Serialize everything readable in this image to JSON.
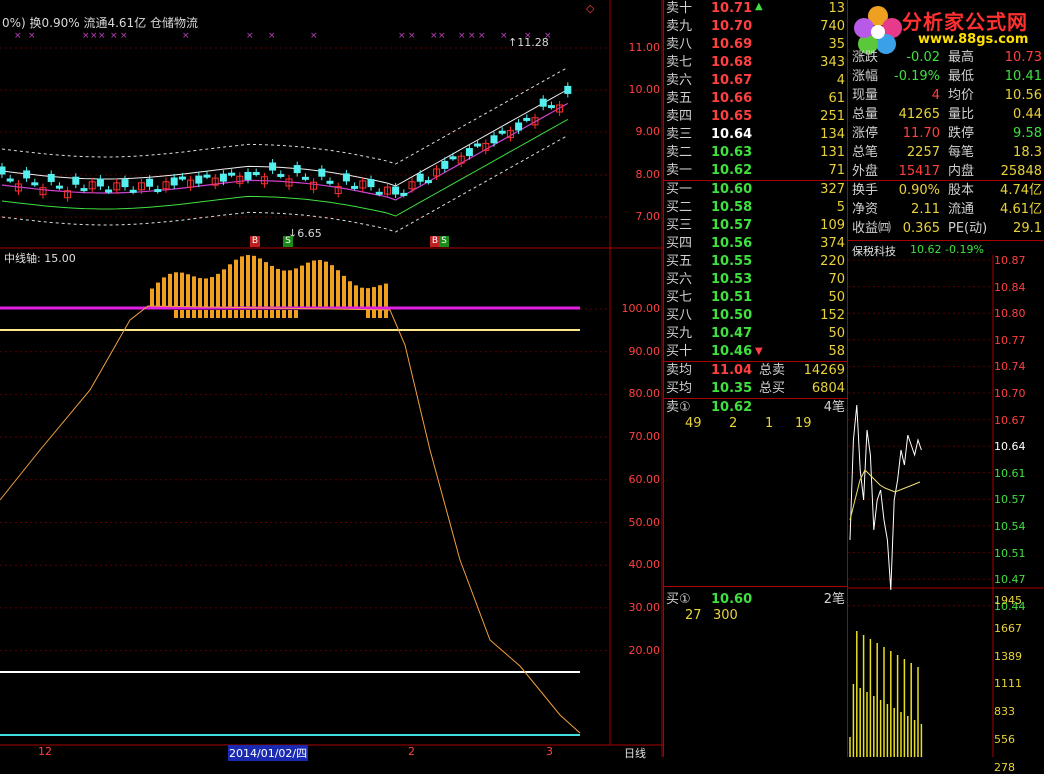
{
  "header": {
    "text_prefix": "0%) 换0.90% 流通4.61亿 仓储物流",
    "marker_high": "11.28",
    "marker_low": "6.65",
    "top_icon": "◇"
  },
  "indicator": {
    "title": "中线轴: 15.00"
  },
  "x_axis": {
    "ticks": [
      "12",
      "2014/01/02/四",
      "2",
      "3"
    ],
    "period": "日线"
  },
  "main_axis": {
    "labels": [
      "11.00",
      "10.00",
      "9.00",
      "8.00",
      "7.00"
    ]
  },
  "ind_axis": {
    "labels": [
      "100.00",
      "90.00",
      "80.00",
      "70.00",
      "60.00",
      "50.00",
      "40.00",
      "30.00",
      "20.00"
    ]
  },
  "signals": [
    {
      "text": "B",
      "type": "buy"
    },
    {
      "text": "S",
      "type": "sell"
    },
    {
      "text": "B",
      "type": "buy"
    },
    {
      "text": "S",
      "type": "sell"
    }
  ],
  "order_book": {
    "asks": [
      {
        "label": "卖十",
        "price": "10.71",
        "vol": "13"
      },
      {
        "label": "卖九",
        "price": "10.70",
        "vol": "740"
      },
      {
        "label": "卖八",
        "price": "10.69",
        "vol": "35"
      },
      {
        "label": "卖七",
        "price": "10.68",
        "vol": "343"
      },
      {
        "label": "卖六",
        "price": "10.67",
        "vol": "4"
      },
      {
        "label": "卖五",
        "price": "10.66",
        "vol": "61"
      },
      {
        "label": "卖四",
        "price": "10.65",
        "vol": "251"
      },
      {
        "label": "卖三",
        "price": "10.64",
        "vol": "134"
      },
      {
        "label": "卖二",
        "price": "10.63",
        "vol": "131"
      },
      {
        "label": "卖一",
        "price": "10.62",
        "vol": "71"
      }
    ],
    "bids": [
      {
        "label": "买一",
        "price": "10.60",
        "vol": "327"
      },
      {
        "label": "买二",
        "price": "10.58",
        "vol": "5"
      },
      {
        "label": "买三",
        "price": "10.57",
        "vol": "109"
      },
      {
        "label": "买四",
        "price": "10.56",
        "vol": "374"
      },
      {
        "label": "买五",
        "price": "10.55",
        "vol": "220"
      },
      {
        "label": "买六",
        "price": "10.53",
        "vol": "70"
      },
      {
        "label": "买七",
        "price": "10.51",
        "vol": "50"
      },
      {
        "label": "买八",
        "price": "10.50",
        "vol": "152"
      },
      {
        "label": "买九",
        "price": "10.47",
        "vol": "50"
      },
      {
        "label": "买十",
        "price": "10.46",
        "vol": "58"
      }
    ],
    "avg_sell": {
      "label": "卖均",
      "price": "11.04",
      "total_label": "总卖",
      "total": "14269"
    },
    "avg_buy": {
      "label": "买均",
      "price": "10.35",
      "total_label": "总买",
      "total": "6804"
    },
    "sell1": {
      "label": "卖①",
      "price": "10.62",
      "count": "4笔",
      "queue": [
        "49",
        "2",
        "1",
        "19"
      ]
    },
    "buy1": {
      "label": "买①",
      "price": "10.60",
      "count": "2笔",
      "queue": [
        "27",
        "300"
      ]
    }
  },
  "quote": {
    "logo": "分析家公式网",
    "logo_url": "www.88gs.com",
    "rows": [
      {
        "l1": "涨跌",
        "v1": "-0.02",
        "l2": "最高",
        "v2": "10.73"
      },
      {
        "l1": "涨幅",
        "v1": "-0.19%",
        "l2": "最低",
        "v2": "10.41"
      },
      {
        "l1": "现量",
        "v1": "4",
        "l2": "均价",
        "v2": "10.56"
      },
      {
        "l1": "总量",
        "v1": "41265",
        "l2": "量比",
        "v2": "0.44"
      },
      {
        "l1": "涨停",
        "v1": "11.70",
        "l2": "跌停",
        "v2": "9.58"
      },
      {
        "l1": "总笔",
        "v1": "2257",
        "l2": "每笔",
        "v2": "18.3"
      },
      {
        "l1": "外盘",
        "v1": "15417",
        "l2": "内盘",
        "v2": "25848"
      },
      {
        "l1": "换手",
        "v1": "0.90%",
        "l2": "股本",
        "v2": "4.74亿"
      },
      {
        "l1": "净资",
        "v1": "2.11",
        "l2": "流通",
        "v2": "4.61亿"
      },
      {
        "l1": "收益㈣",
        "v1": "0.365",
        "l2": "PE(动)",
        "v2": "29.1"
      }
    ]
  },
  "mini": {
    "name": "保税科技",
    "price": "10.62",
    "change": "-0.19%",
    "price_labels": [
      "10.87",
      "10.84",
      "10.80",
      "10.77",
      "10.74",
      "10.70",
      "10.67",
      "10.64",
      "10.61",
      "10.57",
      "10.54",
      "10.51",
      "10.47",
      "10.44"
    ],
    "vol_labels": [
      "1945",
      "1667",
      "1389",
      "1111",
      "833",
      "556",
      "278"
    ]
  }
}
